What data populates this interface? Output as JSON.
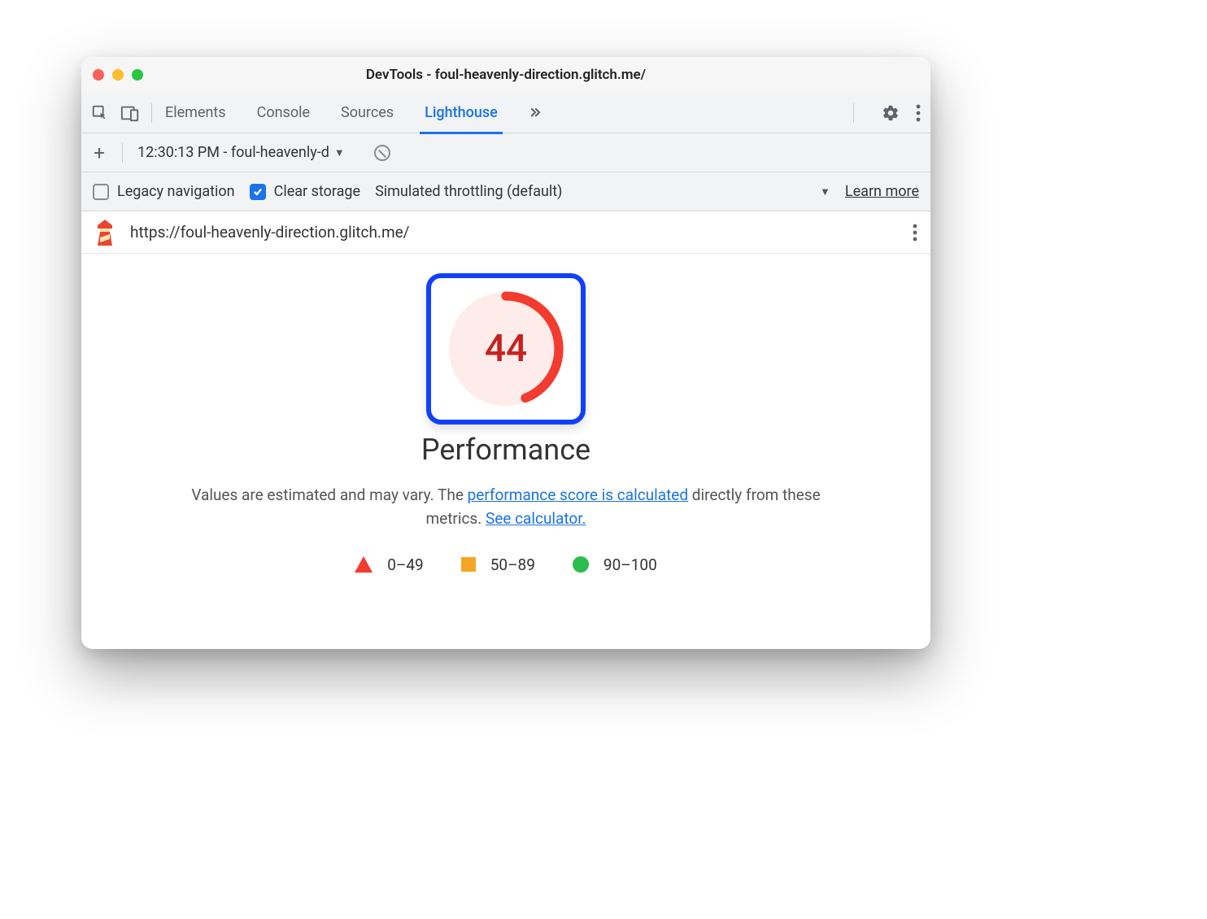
{
  "window": {
    "title": "DevTools - foul-heavenly-direction.glitch.me/"
  },
  "toolbar": {
    "tabs": {
      "elements": "Elements",
      "console": "Console",
      "sources": "Sources",
      "lighthouse": "Lighthouse"
    }
  },
  "audit": {
    "selected_label": "12:30:13 PM - foul-heavenly-d"
  },
  "options": {
    "legacy_nav_label": "Legacy navigation",
    "clear_storage_label": "Clear storage",
    "throttling_label": "Simulated throttling (default)",
    "learn_more": "Learn more"
  },
  "report": {
    "url": "https://foul-heavenly-direction.glitch.me/",
    "score": "44",
    "category": "Performance",
    "desc_a": "Values are estimated and may vary. The ",
    "desc_link1": "performance score is calculated",
    "desc_b": " directly from these metrics. ",
    "desc_link2": "See calculator.",
    "legend": {
      "poor": "0–49",
      "mid": "50–89",
      "good": "90–100"
    }
  },
  "colors": {
    "fail": "#f33b2f",
    "fail_dark": "#c5221f",
    "accent": "#1a73e8"
  }
}
